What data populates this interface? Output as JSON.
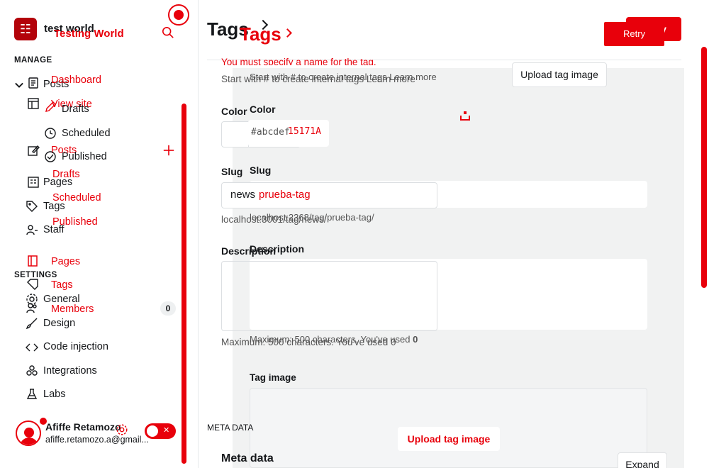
{
  "site": {
    "title_a": "test world",
    "title_b": "Testing World"
  },
  "sidebar": {
    "manage_label": "MANAGE",
    "settings_label": "SETTINGS",
    "items": {
      "dashboard": "Dashboard",
      "view_site": "View site",
      "posts": "Posts",
      "posts_dup": "Posts",
      "drafts": "Drafts",
      "drafts_dup": "Drafts",
      "scheduled": "Scheduled",
      "scheduled_dup": "Scheduled",
      "published": "Published",
      "published_dup": "Published",
      "pages": "Pages",
      "pages_dup": "Pages",
      "tags": "Tags",
      "tags_dup": "Tags",
      "staff": "Staff",
      "members": "Members",
      "members_count": "0",
      "general": "General",
      "design": "Design",
      "code_injection": "Code injection",
      "integrations": "Integrations",
      "labs": "Labs"
    },
    "user": {
      "name": "Afiffe Retamozo",
      "email": "afiffe.retamozo.a@gmail..."
    }
  },
  "header": {
    "breadcrumb_a": "Tags",
    "breadcrumb_b": "Tags",
    "retry_a": "Retry",
    "retry_b": "Retry"
  },
  "form": {
    "error_name": "You must specify a name for the tag.",
    "hint_internal": "Start with # to create internal tags Learn more",
    "hint_internal_dup": "Start with # to create internal tags Learn more",
    "upload_button": "Upload tag image",
    "upload_button_dup": "Upload tag image",
    "color_label": "Color",
    "color_label_dup": "Color",
    "color_placeholder": "#abcdef",
    "color_value": "15171A",
    "slug_label": "Slug",
    "slug_label_dup": "Slug",
    "slug_value": "news",
    "slug_value_dup": "prueba-tag",
    "slug_url": "localhost:3001/tag/news/",
    "slug_url_dup": "localhost:2368/tag/prueba-tag/",
    "description_label": "Description",
    "description_label_dup": "Description",
    "desc_hint": "Maximum: 500 characters. You've used ",
    "desc_count": "0",
    "desc_hint_dup": "Maximum: 500 characters. You've used ",
    "desc_count_dup": "0",
    "tag_image_label": "Tag image",
    "meta_label_small": "META DATA",
    "meta_label": "Meta data",
    "expand_button": "Expand"
  },
  "colors": {
    "accent": "#e8000b",
    "dark_red": "#b3030a",
    "text": "#15171a"
  }
}
